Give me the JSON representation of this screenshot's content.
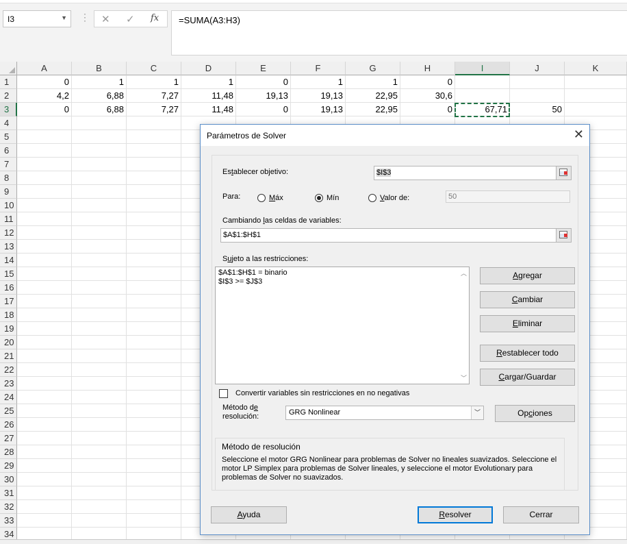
{
  "formula_bar": {
    "name_box": "I3",
    "formula": "=SUMA(A3:H3)",
    "cancel_glyph": "✕",
    "enter_glyph": "✓",
    "fx_glyph": "fx",
    "dots": "⋮"
  },
  "columns": [
    "A",
    "B",
    "C",
    "D",
    "E",
    "F",
    "G",
    "H",
    "I",
    "J",
    "K"
  ],
  "rows": [
    "1",
    "2",
    "3",
    "4",
    "5",
    "6",
    "7",
    "8",
    "9",
    "10",
    "11",
    "12",
    "13",
    "14",
    "15",
    "16",
    "17",
    "18",
    "19",
    "20",
    "21",
    "22",
    "23",
    "24",
    "25",
    "26",
    "27",
    "28",
    "29",
    "30",
    "31",
    "32",
    "33",
    "34"
  ],
  "cells": {
    "row1": [
      "0",
      "1",
      "1",
      "1",
      "0",
      "1",
      "1",
      "0",
      "",
      "",
      ""
    ],
    "row2": [
      "4,2",
      "6,88",
      "7,27",
      "11,48",
      "19,13",
      "19,13",
      "22,95",
      "30,6",
      "",
      "",
      ""
    ],
    "row3": [
      "0",
      "6,88",
      "7,27",
      "11,48",
      "0",
      "19,13",
      "22,95",
      "0",
      "67,71",
      "50",
      ""
    ]
  },
  "dialog": {
    "title": "Parámetros de Solver",
    "close_glyph": "✕",
    "objective_label_pre": "Es",
    "objective_label_u": "t",
    "objective_label_post": "ablecer objetivo:",
    "objective_value": "$I$3",
    "to_label": "Para:",
    "opt_max_u": "M",
    "opt_max_rest": "áx",
    "opt_min": "Mín",
    "opt_value_u": "V",
    "opt_value_rest": "alor de:",
    "value_of": "50",
    "selected_option": "min",
    "changing_label_pre": "Cambiando ",
    "changing_label_u": "l",
    "changing_label_post": "as celdas de variables:",
    "changing_value": "$A$1:$H$1",
    "subject_label_pre": "S",
    "subject_label_u": "u",
    "subject_label_post": "jeto a las restricciones:",
    "constraints": [
      "$A$1:$H$1 = binario",
      "$I$3 >= $J$3"
    ],
    "btn_add_u": "A",
    "btn_add_rest": "gregar",
    "btn_change_u": "C",
    "btn_change_rest": "ambiar",
    "btn_delete_u": "E",
    "btn_delete_rest": "liminar",
    "btn_reset_u": "R",
    "btn_reset_rest": "establecer todo",
    "btn_loadsave_u": "C",
    "btn_loadsave_rest": "argar/Guardar",
    "nonneg_label": "Convertir variables sin restricciones en no negativas",
    "nonneg_checked": false,
    "method_label_line1_pre": "Método d",
    "method_label_line1_u": "e",
    "method_label_line2": "resolución:",
    "method_value": "GRG Nonlinear",
    "btn_options_pre": "Op",
    "btn_options_u": "c",
    "btn_options_post": "iones",
    "method_group_title": "Método de resolución",
    "method_description": "Seleccione el motor GRG Nonlinear para problemas de Solver no lineales suavizados. Seleccione el motor LP Simplex para problemas de Solver lineales, y seleccione el motor Evolutionary para problemas de Solver no suavizados.",
    "btn_help_u": "A",
    "btn_help_rest": "yuda",
    "btn_solve_u": "R",
    "btn_solve_rest": "esolver",
    "btn_close": "Cerrar"
  }
}
